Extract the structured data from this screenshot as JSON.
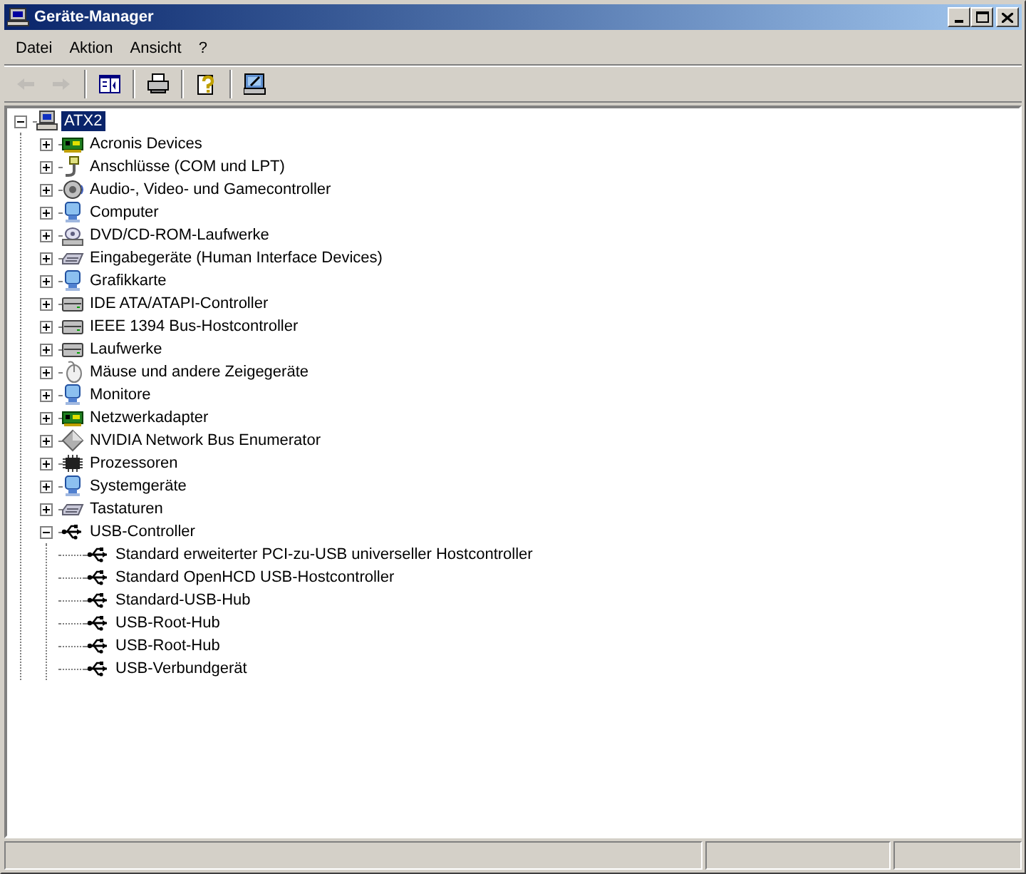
{
  "window": {
    "title": "Geräte-Manager"
  },
  "menu": [
    "Datei",
    "Aktion",
    "Ansicht",
    "?"
  ],
  "toolbar": [
    {
      "kind": "back",
      "disabled": true
    },
    {
      "kind": "forward",
      "disabled": true
    },
    {
      "kind": "separator"
    },
    {
      "kind": "tree-pane",
      "disabled": false
    },
    {
      "kind": "separator"
    },
    {
      "kind": "print",
      "disabled": false
    },
    {
      "kind": "separator"
    },
    {
      "kind": "help",
      "disabled": false
    },
    {
      "kind": "separator"
    },
    {
      "kind": "scan",
      "disabled": false
    }
  ],
  "tree": {
    "label": "ATX2",
    "kind": "computer",
    "selected": true,
    "expanded": true,
    "children": [
      {
        "label": "Acronis Devices",
        "kind": "card",
        "selected": false,
        "expanded": false
      },
      {
        "label": "Anschlüsse (COM und LPT)",
        "kind": "plug",
        "selected": false,
        "expanded": false
      },
      {
        "label": "Audio-, Video- und Gamecontroller",
        "kind": "speaker",
        "selected": false,
        "expanded": false
      },
      {
        "label": "Computer",
        "kind": "monitor",
        "selected": false,
        "expanded": false
      },
      {
        "label": "DVD/CD-ROM-Laufwerke",
        "kind": "disc",
        "selected": false,
        "expanded": false
      },
      {
        "label": "Eingabegeräte (Human Interface Devices)",
        "kind": "keyboard",
        "selected": false,
        "expanded": false
      },
      {
        "label": "Grafikkarte",
        "kind": "monitor",
        "selected": false,
        "expanded": false
      },
      {
        "label": "IDE ATA/ATAPI-Controller",
        "kind": "drive",
        "selected": false,
        "expanded": false
      },
      {
        "label": "IEEE 1394 Bus-Hostcontroller",
        "kind": "drive",
        "selected": false,
        "expanded": false
      },
      {
        "label": "Laufwerke",
        "kind": "drive",
        "selected": false,
        "expanded": false
      },
      {
        "label": "Mäuse und andere Zeigegeräte",
        "kind": "mouse",
        "selected": false,
        "expanded": false
      },
      {
        "label": "Monitore",
        "kind": "monitor",
        "selected": false,
        "expanded": false
      },
      {
        "label": "Netzwerkadapter",
        "kind": "card",
        "selected": false,
        "expanded": false
      },
      {
        "label": "NVIDIA Network Bus Enumerator",
        "kind": "diamond",
        "selected": false,
        "expanded": false
      },
      {
        "label": "Prozessoren",
        "kind": "chip",
        "selected": false,
        "expanded": false
      },
      {
        "label": "Systemgeräte",
        "kind": "monitor",
        "selected": false,
        "expanded": false
      },
      {
        "label": "Tastaturen",
        "kind": "keyboard",
        "selected": false,
        "expanded": false
      },
      {
        "label": "USB-Controller",
        "kind": "usb",
        "selected": false,
        "expanded": true,
        "children": [
          {
            "label": "Standard erweiterter PCI-zu-USB universeller Hostcontroller",
            "kind": "usb",
            "selected": false
          },
          {
            "label": "Standard OpenHCD USB-Hostcontroller",
            "kind": "usb",
            "selected": false
          },
          {
            "label": "Standard-USB-Hub",
            "kind": "usb",
            "selected": false
          },
          {
            "label": "USB-Root-Hub",
            "kind": "usb",
            "selected": false
          },
          {
            "label": "USB-Root-Hub",
            "kind": "usb",
            "selected": false
          },
          {
            "label": "USB-Verbundgerät",
            "kind": "usb",
            "selected": false
          }
        ]
      }
    ]
  }
}
